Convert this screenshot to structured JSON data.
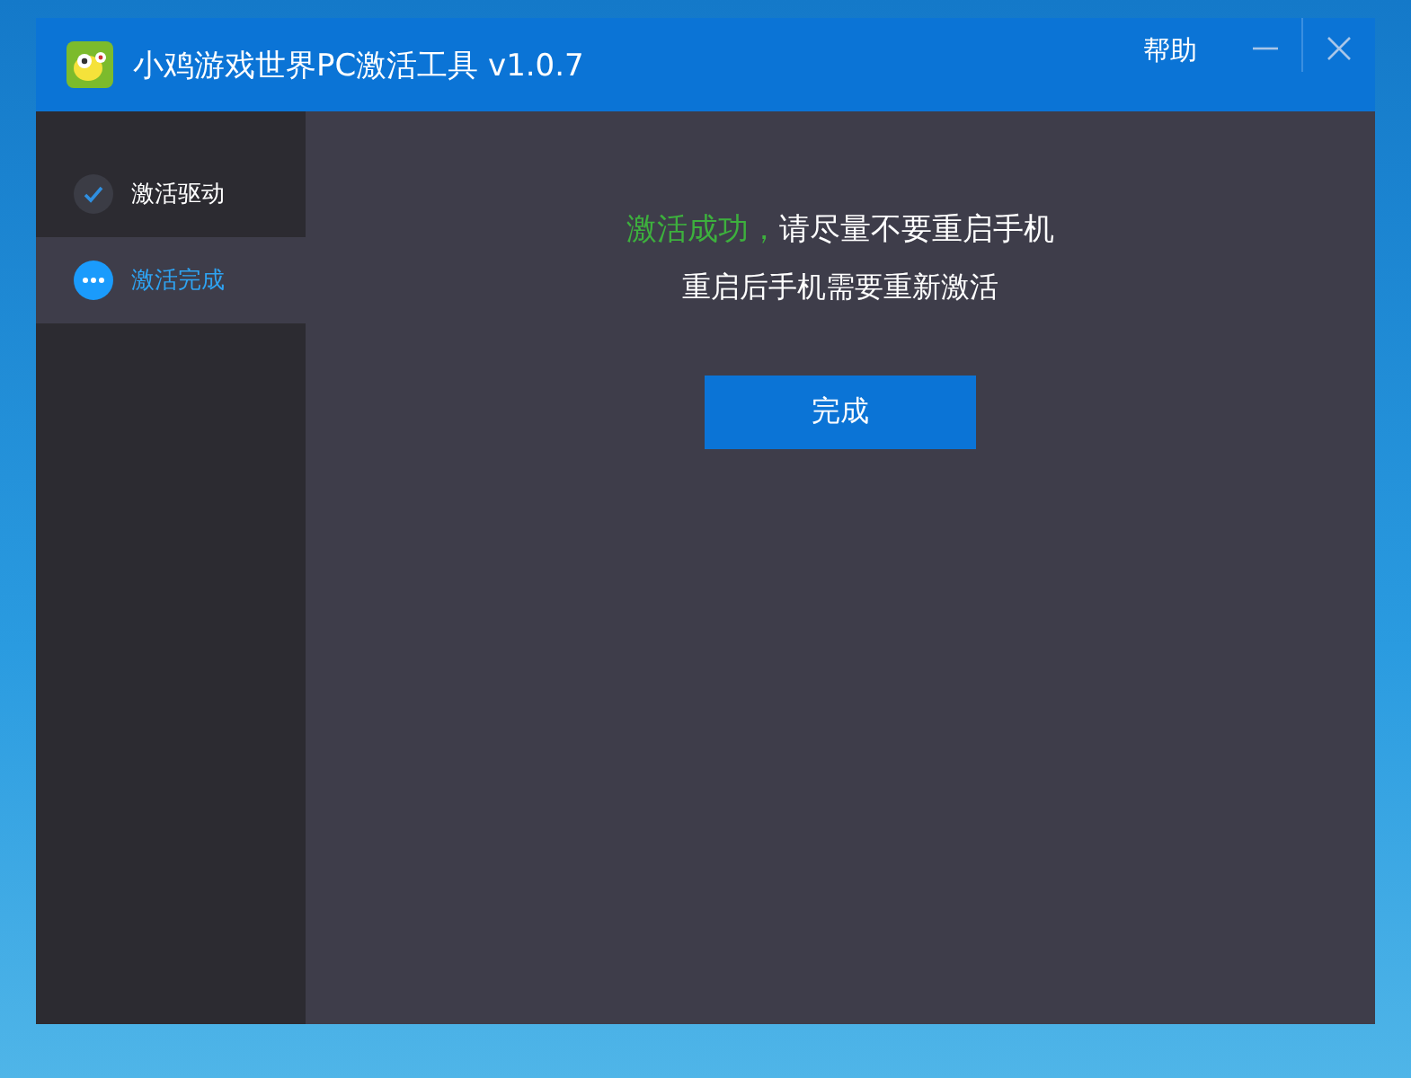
{
  "window": {
    "title": "小鸡游戏世界PC激活工具 v1.0.7",
    "help": "帮助"
  },
  "steps": [
    {
      "label": "激活驱动",
      "kind": "done",
      "selected": false
    },
    {
      "label": "激活完成",
      "kind": "current",
      "selected": true
    }
  ],
  "result": {
    "status": "激活成功，",
    "message": "请尽量不要重启手机",
    "note": "重启后手机需要重新激活",
    "button": "完成"
  }
}
